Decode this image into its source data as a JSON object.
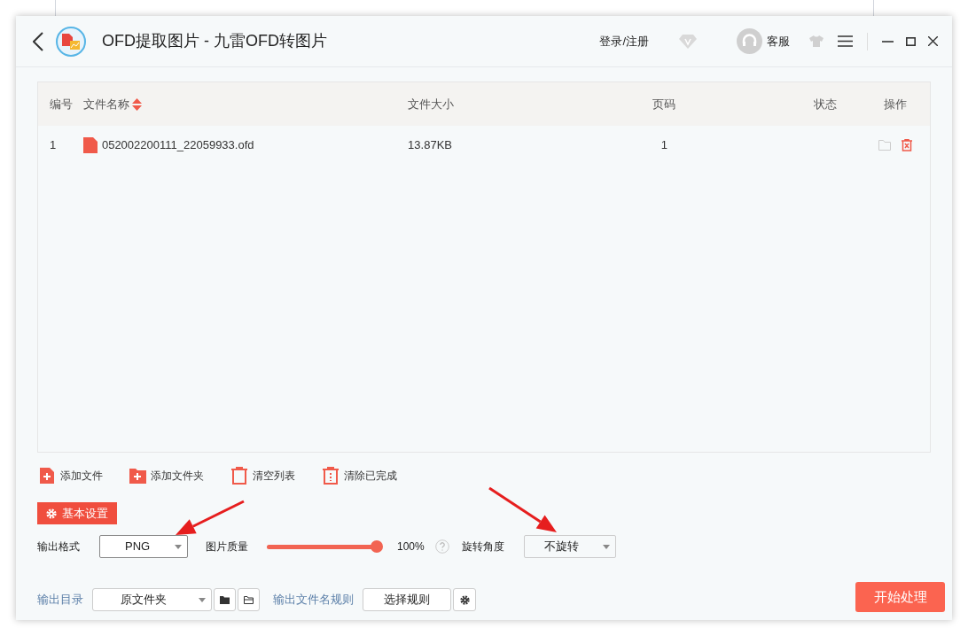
{
  "window": {
    "title": "OFD提取图片 - 九雷OFD转图片"
  },
  "header": {
    "login": "登录/注册",
    "support": "客服"
  },
  "table": {
    "columns": [
      {
        "label": "编号",
        "sortable": false
      },
      {
        "label": "文件名称",
        "sortable": true
      },
      {
        "label": "文件大小",
        "sortable": false
      },
      {
        "label": "页码",
        "sortable": false
      },
      {
        "label": "状态",
        "sortable": false
      },
      {
        "label": "操作",
        "sortable": false
      }
    ],
    "rows": [
      {
        "index": "1",
        "name": "052002200111_22059933.ofd",
        "size": "13.87KB",
        "pages": "1"
      }
    ]
  },
  "toolbar": [
    {
      "label": "添加文件",
      "kind": "add-file"
    },
    {
      "label": "添加文件夹",
      "kind": "add-folder"
    },
    {
      "label": "清空列表",
      "kind": "clear"
    },
    {
      "label": "清除已完成",
      "kind": "clear-done"
    }
  ],
  "settings_tab": "基本设置",
  "settings": {
    "format": {
      "label": "输出格式",
      "value": "PNG"
    },
    "quality": {
      "label": "图片质量",
      "level": 1,
      "reading": "100%"
    },
    "rotation": {
      "label": "旋转角度",
      "value": "不旋转"
    }
  },
  "output": {
    "dir_label": "输出目录",
    "dir_value": "原文件夹",
    "rule_label": "输出文件名规则",
    "rule_button": "选择规则",
    "start_button": "开始处理"
  }
}
